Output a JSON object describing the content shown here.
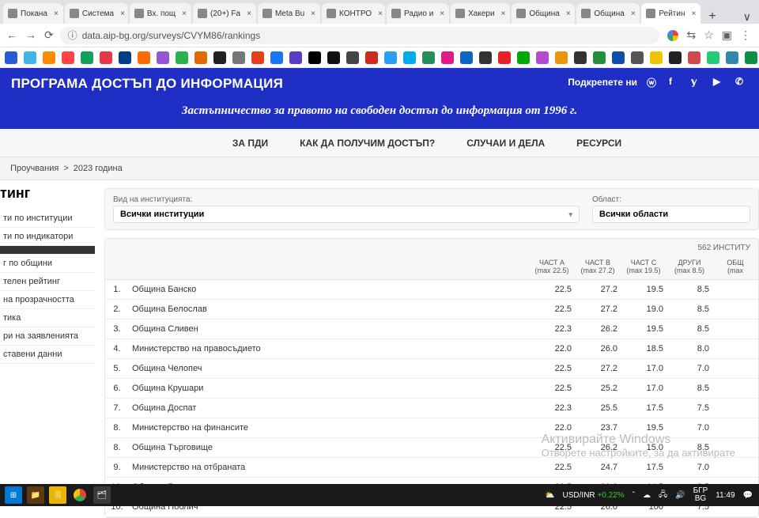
{
  "browser": {
    "tabs": [
      {
        "label": "Покана"
      },
      {
        "label": "Система"
      },
      {
        "label": "Вх. пощ"
      },
      {
        "label": "(20+) Fa"
      },
      {
        "label": "Meta Bu"
      },
      {
        "label": "КОНТРО"
      },
      {
        "label": "Радио и"
      },
      {
        "label": "Хакери"
      },
      {
        "label": "Община"
      },
      {
        "label": "Община"
      },
      {
        "label": "Рейтин",
        "active": true
      }
    ],
    "url": "data.aip-bg.org/surveys/CVYM86/rankings"
  },
  "header": {
    "title": "ПРОГРАМА ДОСТЪП ДО ИНФОРМАЦИЯ",
    "support": "Подкрепете ни",
    "subtitle": "Застъпничество за правото на свободен достъп до информация от 1996 г."
  },
  "mainnav": [
    "ЗА ПДИ",
    "КАК ДА ПОЛУЧИМ ДОСТЪП?",
    "СЛУЧАИ И ДЕЛА",
    "РЕСУРСИ"
  ],
  "crumbs": [
    "Проучвания",
    "2023 година"
  ],
  "pageheading": "тинг",
  "sidenav": [
    "ти по институции",
    "ти по индикатори",
    "",
    "г по общини",
    "телен рейтинг",
    "на прозрачността",
    "тика",
    "ри на заявленията",
    "ставени данни"
  ],
  "sidenav_active_index": 2,
  "filters": {
    "type_label": "Вид на институцията:",
    "type_value": "Всички институции",
    "region_label": "Област:",
    "region_value": "Всички области"
  },
  "table": {
    "count": "562 ИНСТИТУ",
    "cols": [
      {
        "t": "ЧАСТ А",
        "m": "(max 22.5)"
      },
      {
        "t": "ЧАСТ В",
        "m": "(max 27.2)"
      },
      {
        "t": "ЧАСТ С",
        "m": "(max 19.5)"
      },
      {
        "t": "ДРУГИ",
        "m": "(max 8.5)"
      },
      {
        "t": "ОБЩ",
        "m": "(max"
      }
    ],
    "rows": [
      {
        "n": "1.",
        "name": "Община Банско",
        "a": "22.5",
        "b": "27.2",
        "c": "19.5",
        "d": "8.5"
      },
      {
        "n": "2.",
        "name": "Община Белослав",
        "a": "22.5",
        "b": "27.2",
        "c": "19.0",
        "d": "8.5"
      },
      {
        "n": "3.",
        "name": "Община Сливен",
        "a": "22.3",
        "b": "26.2",
        "c": "19.5",
        "d": "8.5"
      },
      {
        "n": "4.",
        "name": "Министерство на правосъдието",
        "a": "22.0",
        "b": "26.0",
        "c": "18.5",
        "d": "8.0"
      },
      {
        "n": "5.",
        "name": "Община Челопеч",
        "a": "22.5",
        "b": "27.2",
        "c": "17.0",
        "d": "7.0"
      },
      {
        "n": "6.",
        "name": "Община Крушари",
        "a": "22.5",
        "b": "25.2",
        "c": "17.0",
        "d": "8.5"
      },
      {
        "n": "7.",
        "name": "Община Доспат",
        "a": "22.3",
        "b": "25.5",
        "c": "17.5",
        "d": "7.5"
      },
      {
        "n": "8.",
        "name": "Министерство на финансите",
        "a": "22.0",
        "b": "23.7",
        "c": "19.5",
        "d": "7.0"
      },
      {
        "n": "8.",
        "name": "Община Търговище",
        "a": "22.5",
        "b": "26.2",
        "c": "15.0",
        "d": "8.5"
      },
      {
        "n": "9.",
        "name": "Министерство на отбраната",
        "a": "22.5",
        "b": "24.7",
        "c": "17.5",
        "d": "7.0"
      },
      {
        "n": "10.",
        "name": "Община Белоградчик",
        "a": "22.5",
        "b": "26.0",
        "c": "14.5",
        "d": "8.5"
      },
      {
        "n": "10.",
        "name": "Община Поблич",
        "a": "22.5",
        "b": "26.0",
        "c": "100",
        "d": "7.5"
      }
    ]
  },
  "watermark": {
    "l1": "Активирайте Windows",
    "l2": "Отворете настройките, за да активирате"
  },
  "taskbar": {
    "stock_pair": "USD/INR",
    "stock_change": "+0.22%",
    "time": "11:49",
    "date": "",
    "lang1": "БГР",
    "lang2": "BG"
  },
  "bookmark_colors": [
    "#2a5bd7",
    "#3fb4e8",
    "#ff8a00",
    "#ff4444",
    "#12a05c",
    "#e63946",
    "#043b8a",
    "#ff6b00",
    "#9754d6",
    "#2bb24c",
    "#e26a00",
    "#222",
    "#777",
    "#e63e1b",
    "#1877f2",
    "#5b3cc4",
    "#000",
    "#111",
    "#444",
    "#cc2b1d",
    "#2a9df4",
    "#00acee",
    "#278e5b",
    "#e01b84",
    "#0b65c2",
    "#333",
    "#eb1f2a",
    "#0a0",
    "#b44cd2",
    "#e99510",
    "#333",
    "#258f3b",
    "#0e4daa",
    "#555",
    "#f0c400",
    "#222",
    "#d04848",
    "#2c7",
    "#38a",
    "#0b9146",
    "#1b8",
    "#5a3",
    "#e3395b"
  ]
}
